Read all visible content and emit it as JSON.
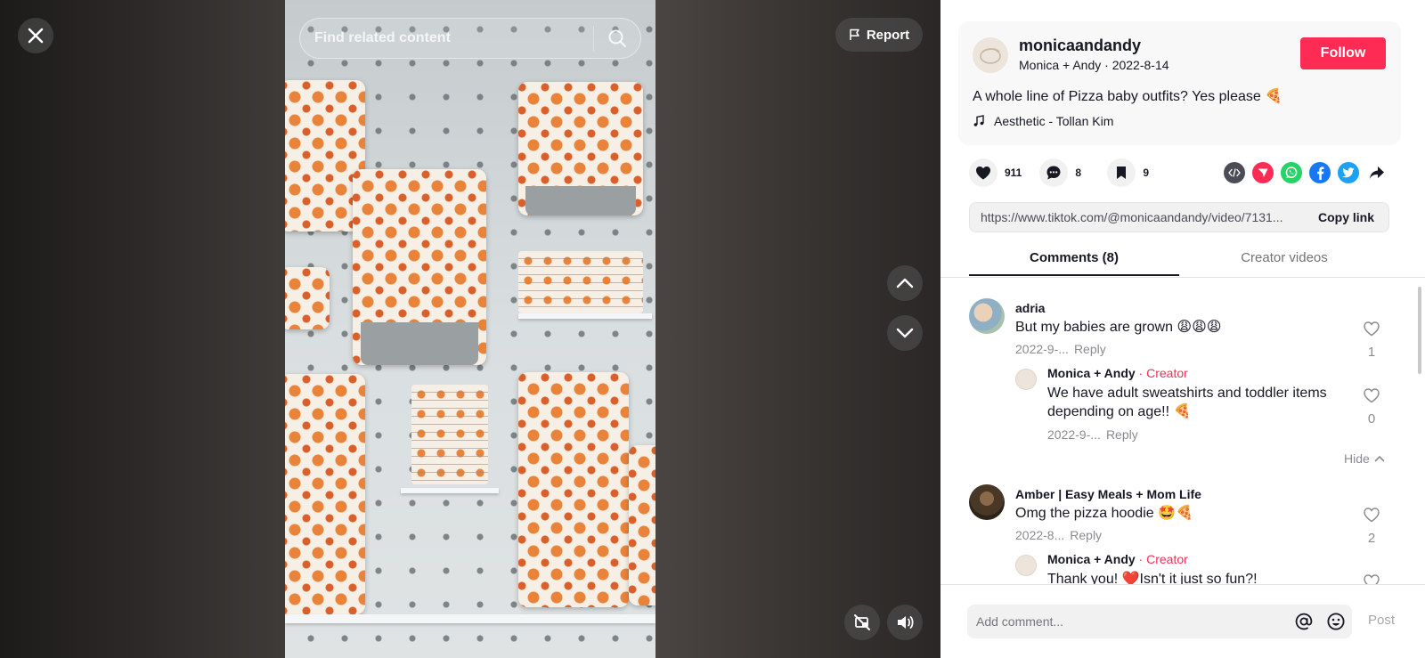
{
  "video": {
    "search_placeholder": "Find related content",
    "report_label": "Report"
  },
  "author": {
    "username": "monicaandandy",
    "display_name": "Monica + Andy",
    "date": "2022-8-14",
    "separator": " · ",
    "follow_label": "Follow"
  },
  "caption": "A whole line of Pizza baby outfits? Yes please 🍕",
  "music": "Aesthetic - Tollan Kim",
  "stats": {
    "likes": "911",
    "comments": "8",
    "saves": "9"
  },
  "share_link": {
    "url": "https://www.tiktok.com/@monicaandandy/video/7131...",
    "copy_label": "Copy link"
  },
  "tabs": [
    {
      "label": "Comments (8)",
      "active": true
    },
    {
      "label": "Creator videos",
      "active": false
    }
  ],
  "comments": [
    {
      "name": "adria",
      "text": "But my babies are grown 😩😩😩",
      "date": "2022-9-...",
      "reply_label": "Reply",
      "likes": "1",
      "replies": [
        {
          "name": "Monica + Andy",
          "badge": " · Creator",
          "text_line1": "We have adult sweatshirts and toddler items",
          "text_line2": "depending on age!! 🍕",
          "date": "2022-9-...",
          "reply_label": "Reply",
          "likes": "0"
        }
      ],
      "hide_label": "Hide"
    },
    {
      "name": "Amber | Easy Meals + Mom Life",
      "text": "Omg the pizza hoodie 🤩🍕",
      "date": "2022-8...",
      "reply_label": "Reply",
      "likes": "2",
      "replies": [
        {
          "name": "Monica + Andy",
          "badge": " · Creator",
          "text": "Thank you! ❤️Isn't it just so fun?!",
          "likes": ""
        }
      ]
    }
  ],
  "comment_input": {
    "placeholder": "Add comment...",
    "post_label": "Post"
  },
  "colors": {
    "accent": "#fe2c55",
    "whatsapp": "#25d366",
    "facebook": "#1877f2",
    "twitter": "#1da1f2",
    "embed": "#4b4c55"
  },
  "icons": [
    "close-icon",
    "search-icon",
    "flag-icon",
    "chevron-up-icon",
    "chevron-down-icon",
    "pip-icon",
    "volume-icon",
    "music-note-icon",
    "heart-icon",
    "comment-icon",
    "bookmark-icon",
    "embed-icon",
    "send-icon",
    "whatsapp-icon",
    "facebook-icon",
    "twitter-icon",
    "share-arrow-icon",
    "at-icon",
    "emoji-icon"
  ]
}
